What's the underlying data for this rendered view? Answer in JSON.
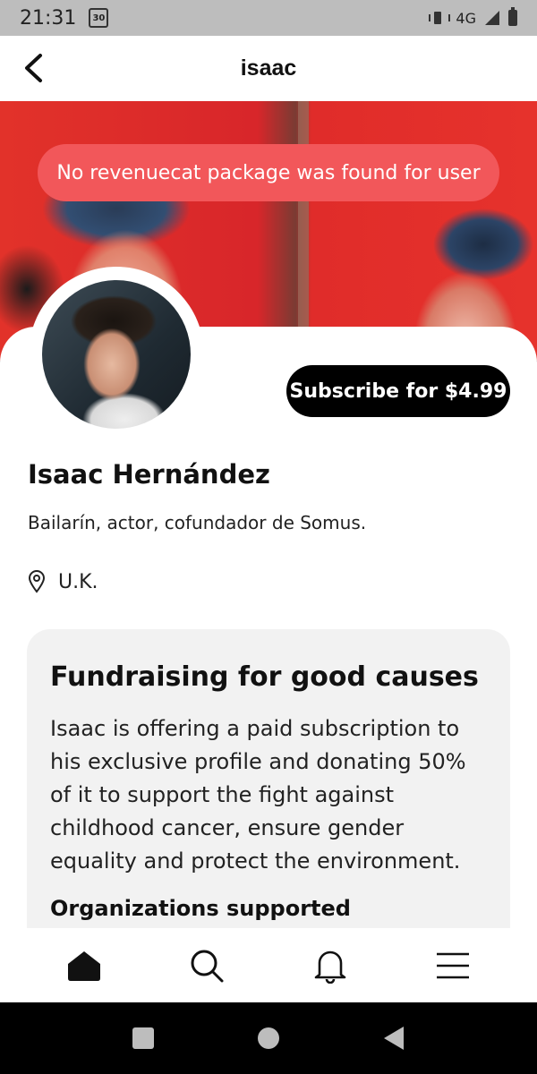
{
  "status_bar": {
    "time": "21:31",
    "calendar_day": "30",
    "network": "4G"
  },
  "header": {
    "title": "isaac"
  },
  "toast": {
    "message": "No revenuecat package was found for user"
  },
  "profile": {
    "subscribe_label": "Subscribe for $4.99",
    "name": "Isaac Hernández",
    "bio": "Bailarín, actor, cofundador de Somus.",
    "location": "U.K."
  },
  "fundraising": {
    "title": "Fundraising for good causes",
    "body": "Isaac is offering a paid subscription to his exclusive profile and donating 50% of it to support the fight against childhood cancer, ensure gender equality and protect the environment.",
    "organizations_heading": "Organizations supported"
  },
  "bottom_nav": {
    "items": [
      "home-icon",
      "search-icon",
      "bell-icon",
      "menu-icon"
    ],
    "active": "home"
  },
  "colors": {
    "toast_bg": "#f2575a",
    "button_bg": "#000000",
    "card_bg": "#f2f2f2"
  }
}
